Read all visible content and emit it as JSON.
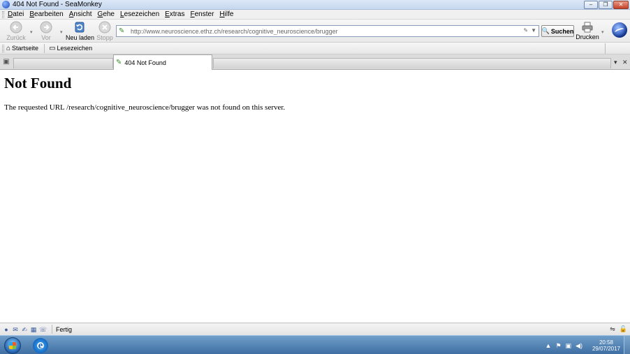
{
  "window": {
    "title": "404 Not Found - SeaMonkey",
    "buttons": {
      "minimize": "–",
      "maximize": "❐",
      "close": "✕"
    }
  },
  "menubar": {
    "items": [
      {
        "accel": "D",
        "rest": "atei"
      },
      {
        "accel": "B",
        "rest": "earbeiten"
      },
      {
        "accel": "A",
        "rest": "nsicht"
      },
      {
        "accel": "G",
        "rest": "ehe"
      },
      {
        "accel": "L",
        "rest": "esezeichen"
      },
      {
        "accel": "E",
        "rest": "xtras"
      },
      {
        "accel": "F",
        "rest": "enster"
      },
      {
        "accel": "H",
        "rest": "ilfe"
      }
    ]
  },
  "navbar": {
    "back_label": "Zurück",
    "forward_label": "Vor",
    "reload_label": "Neu laden",
    "stop_label": "Stopp",
    "url": "http://www.neuroscience.ethz.ch/research/cognitive_neuroscience/brugger",
    "search_label": "Suchen",
    "print_label": "Drucken"
  },
  "personalbar": {
    "home_label": "Startseite",
    "bookmarks_label": "Lesezeichen"
  },
  "tabs": [
    {
      "label": "404 Not Found",
      "active": true
    }
  ],
  "content": {
    "heading": "Not Found",
    "message": "The requested URL /research/cognitive_neuroscience/brugger was not found on this server."
  },
  "statusbar": {
    "text": "Fertig"
  },
  "taskbar": {
    "time": "20:58",
    "date": "29/07/2017"
  },
  "colors": {
    "titlebar": "#c6d7ef",
    "taskbar": "#3f6fa3",
    "link_green": "#3b8a2e"
  }
}
